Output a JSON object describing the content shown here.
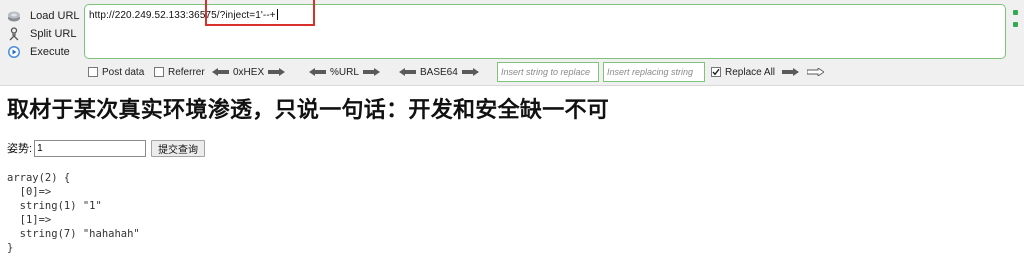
{
  "hackbar": {
    "actions": {
      "load_url": "Load URL",
      "split_url": "Split URL",
      "execute": "Execute"
    },
    "url": "http://220.249.52.133:36575/?inject=1'--+",
    "options": {
      "post_data": "Post data",
      "referrer": "Referrer",
      "hex": "0xHEX",
      "url_enc": "%URL",
      "base64": "BASE64",
      "replace_placeholder": "Insert string to replace",
      "replacing_placeholder": "Insert replacing string",
      "replace_all": "Replace All",
      "replace_all_checked": true
    },
    "colors": {
      "accent_green": "#7fc37a",
      "highlight_red": "#d8312b"
    }
  },
  "page": {
    "title": "取材于某次真实环境渗透，只说一句话：开发和安全缺一不可",
    "form": {
      "label": "姿势:",
      "input_value": "1",
      "submit_label": "提交查询"
    },
    "output": "array(2) {\n  [0]=>\n  string(1) \"1\"\n  [1]=>\n  string(7) \"hahahah\"\n}"
  }
}
